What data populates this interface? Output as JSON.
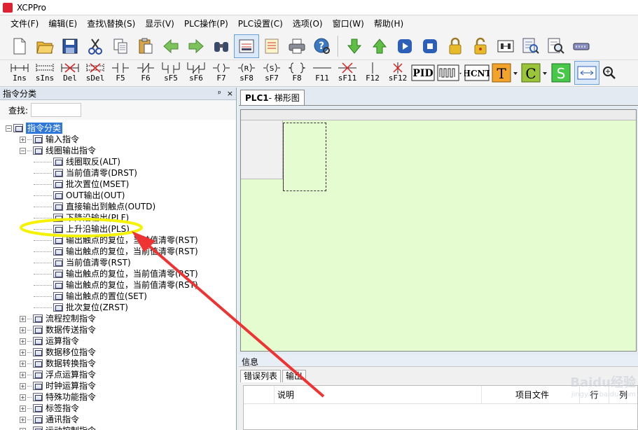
{
  "window": {
    "title": "XCPPro"
  },
  "menu": [
    "文件(F)",
    "编辑(E)",
    "查找\\替换(S)",
    "显示(V)",
    "PLC操作(P)",
    "PLC设置(C)",
    "选项(O)",
    "窗口(W)",
    "帮助(H)"
  ],
  "toolbar_main": {
    "icons": [
      "new-file-icon",
      "open-folder-icon",
      "save-icon",
      "cut-icon",
      "copy-icon",
      "paste-icon",
      "arrow-left-icon",
      "arrow-right-icon",
      "binoculars-icon",
      "ladder-view-icon",
      "list-view-icon",
      "print-icon",
      "help-icon",
      "download-icon",
      "upload-icon",
      "run-icon",
      "stop-icon",
      "lock-icon",
      "unlock-icon",
      "transfer-icon",
      "monitor-search-icon",
      "document-search-icon",
      "device-icon"
    ]
  },
  "toolbar_ladder": {
    "buttons": [
      {
        "label": "Ins",
        "icon": "insert-row-icon"
      },
      {
        "label": "sIns",
        "icon": "shift-insert-icon"
      },
      {
        "label": "Del",
        "icon": "delete-row-icon"
      },
      {
        "label": "sDel",
        "icon": "shift-delete-icon"
      },
      {
        "label": "F5",
        "icon": "no-contact-icon"
      },
      {
        "label": "F6",
        "icon": "nc-contact-icon"
      },
      {
        "label": "sF5",
        "icon": "parallel-no-icon"
      },
      {
        "label": "sF6",
        "icon": "parallel-nc-icon"
      },
      {
        "label": "F7",
        "icon": "coil-icon"
      },
      {
        "label": "sF8",
        "icon": "reset-coil-icon"
      },
      {
        "label": "sF7",
        "icon": "set-coil-icon"
      },
      {
        "label": "F8",
        "icon": "instruction-bracket-icon"
      },
      {
        "label": "F11",
        "icon": "horizontal-line-icon"
      },
      {
        "label": "sF11",
        "icon": "delete-hline-icon"
      },
      {
        "label": "F12",
        "icon": "vertical-line-icon"
      },
      {
        "label": "sF12",
        "icon": "delete-vline-icon"
      }
    ],
    "extra": {
      "pid": "PID",
      "hcnt": "HCNT",
      "t": "T",
      "c": "C",
      "s": "S"
    }
  },
  "left_panel": {
    "title": "指令分类",
    "pin": "ᵖ",
    "close": "×",
    "search_label": "查找:",
    "search_value": "",
    "tree": [
      {
        "level": 0,
        "label": "指令分类",
        "expanded": true,
        "selected": true
      },
      {
        "level": 1,
        "label": "输入指令",
        "expanded": false
      },
      {
        "level": 1,
        "label": "线圈输出指令",
        "expanded": true
      },
      {
        "level": 2,
        "label": "线圈取反(ALT)"
      },
      {
        "level": 2,
        "label": "当前值清零(DRST)"
      },
      {
        "level": 2,
        "label": "批次置位(MSET)"
      },
      {
        "level": 2,
        "label": "OUT输出(OUT)"
      },
      {
        "level": 2,
        "label": "直接输出到触点(OUTD)"
      },
      {
        "level": 2,
        "label": "下降沿输出(PLF)"
      },
      {
        "level": 2,
        "label": "上升沿输出(PLS)",
        "highlighted": true
      },
      {
        "level": 2,
        "label": "输出触点的复位，当前值清零(RST)"
      },
      {
        "level": 2,
        "label": "输出触点的复位，当前值清零(RST)"
      },
      {
        "level": 2,
        "label": "当前值清零(RST)"
      },
      {
        "level": 2,
        "label": "输出触点的复位，当前值清零(RST)"
      },
      {
        "level": 2,
        "label": "输出触点的复位，当前值清零(RST)"
      },
      {
        "level": 2,
        "label": "输出触点的置位(SET)"
      },
      {
        "level": 2,
        "label": "批次复位(ZRST)"
      },
      {
        "level": 1,
        "label": "流程控制指令",
        "expanded": false
      },
      {
        "level": 1,
        "label": "数据传送指令",
        "expanded": false
      },
      {
        "level": 1,
        "label": "运算指令",
        "expanded": false
      },
      {
        "level": 1,
        "label": "数据移位指令",
        "expanded": false
      },
      {
        "level": 1,
        "label": "数据转换指令",
        "expanded": false
      },
      {
        "level": 1,
        "label": "浮点运算指令",
        "expanded": false
      },
      {
        "level": 1,
        "label": "时钟运算指令",
        "expanded": false
      },
      {
        "level": 1,
        "label": "特殊功能指令",
        "expanded": false
      },
      {
        "level": 1,
        "label": "标签指令",
        "expanded": false
      },
      {
        "level": 1,
        "label": "通讯指令",
        "expanded": false
      },
      {
        "level": 1,
        "label": "运动控制指令",
        "expanded": false
      }
    ]
  },
  "editor": {
    "tab_prefix": "PLC1",
    "tab_suffix": " - 梯形图"
  },
  "info_panel": {
    "title": "信息",
    "tabs": [
      "错误列表",
      "输出"
    ],
    "columns": [
      "说明",
      "项目文件",
      "行",
      "列"
    ]
  },
  "watermark": {
    "brand": "Baidu经验",
    "url": "jingyan.baidu.com"
  },
  "annotation": {
    "highlight_color": "#f5f200",
    "arrow_color": "#ee3333"
  }
}
